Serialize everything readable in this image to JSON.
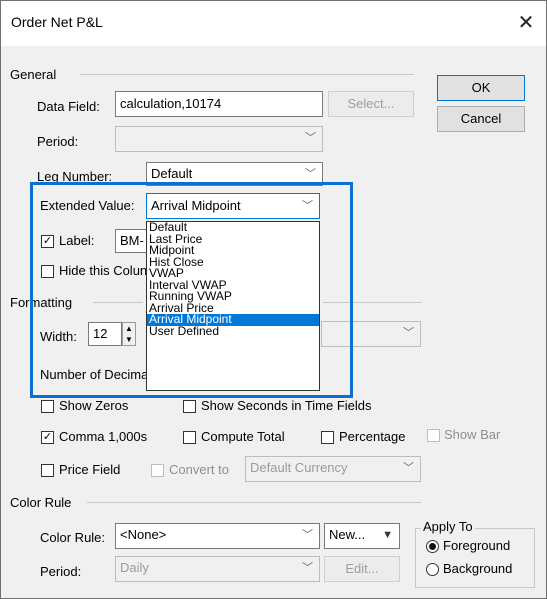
{
  "window": {
    "title": "Order Net P&L",
    "close_glyph": "✕"
  },
  "general": {
    "group_label": "General",
    "data_field_label": "Data Field:",
    "data_field_value": "calculation,10174",
    "select_button": "Select...",
    "period_label": "Period:",
    "period_value": "",
    "leg_number_label": "Leg Number:",
    "leg_number_value": "Default",
    "extended_value_label": "Extended Value:",
    "extended_value_value": "Arrival Midpoint",
    "label_checkbox_label": "Label:",
    "label_checked": true,
    "label_value": "BM-",
    "hide_column_label": "Hide this Colun",
    "hide_column_checked": false
  },
  "dialog_buttons": {
    "ok": "OK",
    "cancel": "Cancel"
  },
  "extended_value_dropdown": {
    "options": [
      "Default",
      "Last Price",
      "Midpoint",
      "Hist Close",
      "VWAP",
      "Interval VWAP",
      "Running VWAP",
      "Arrival Price",
      "Arrival Midpoint",
      "User Defined"
    ],
    "selected_index": 8
  },
  "formatting": {
    "group_label": "Formatting",
    "width_label": "Width:",
    "width_value": "12",
    "right_select_value": "",
    "number_of_decimals_label": "Number of Decima",
    "show_zeros_label": "Show Zeros",
    "show_zeros_checked": false,
    "show_seconds_label": "Show Seconds in Time Fields",
    "show_seconds_checked": false,
    "comma_label": "Comma 1,000s",
    "comma_checked": true,
    "compute_total_label": "Compute Total",
    "compute_total_checked": false,
    "percentage_label": "Percentage",
    "percentage_checked": false,
    "show_bar_label": "Show Bar",
    "show_bar_checked": false,
    "price_field_label": "Price Field",
    "price_field_checked": false,
    "convert_to_label": "Convert to",
    "convert_to_checked": false,
    "currency_value": "Default Currency"
  },
  "color_rule": {
    "group_label": "Color Rule",
    "color_rule_label": "Color Rule:",
    "color_rule_value": "<None>",
    "new_button": "New...",
    "period_label": "Period:",
    "period_value": "Daily",
    "edit_button": "Edit...",
    "apply_to": {
      "group_label": "Apply To",
      "foreground_label": "Foreground",
      "background_label": "Background",
      "selected": "Foreground"
    }
  },
  "colors": {
    "accent": "#0078d7",
    "highlight_border": "#0b70d1"
  },
  "icons": {
    "dropdown": "chevron-down-icon",
    "spin": "spin-arrows-icon"
  }
}
